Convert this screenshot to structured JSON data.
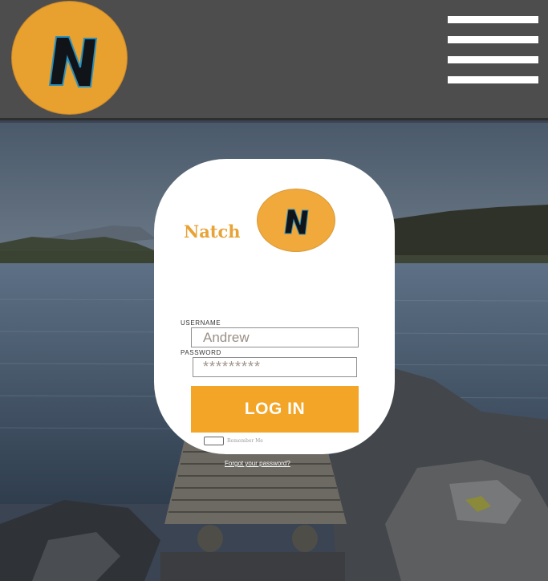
{
  "header": {
    "logo_letter": "N",
    "menu_icon": "hamburger-menu-icon"
  },
  "card": {
    "brand_name": "Natch",
    "logo_letter": "N",
    "username_label": "USERNAME",
    "username_value": "Andrew",
    "password_label": "PASSWORD",
    "password_value": "*********",
    "login_button": "LOG IN",
    "remember_label": "Remember Me"
  },
  "footer": {
    "forgot_link": "Forgot your password?"
  },
  "colors": {
    "header_bg": "#4d4d4d",
    "brand_orange": "#f2a526",
    "card_bg": "#ffffff"
  }
}
